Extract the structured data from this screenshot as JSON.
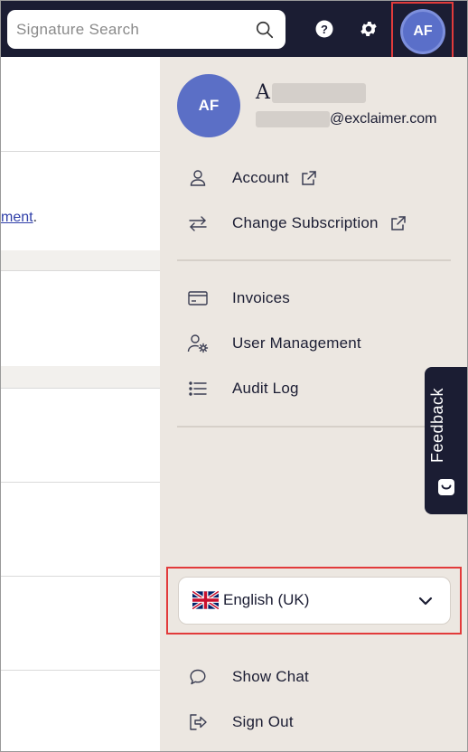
{
  "search": {
    "placeholder": "Signature Search"
  },
  "header": {
    "avatar_initials": "AF"
  },
  "background": {
    "link_tail": "ment",
    "link_after": "."
  },
  "profile": {
    "initials": "AF",
    "name_visible": "A",
    "email_domain": "@exclaimer.com"
  },
  "menu": {
    "account": "Account",
    "change_subscription": "Change Subscription",
    "invoices": "Invoices",
    "user_management": "User Management",
    "audit_log": "Audit Log",
    "show_chat": "Show Chat",
    "sign_out": "Sign Out"
  },
  "feedback": {
    "label": "Feedback"
  },
  "language": {
    "selected": "English (UK)"
  },
  "colors": {
    "topbar": "#1b1d33",
    "panel": "#ece7e1",
    "avatar": "#5b6fc6",
    "highlight": "#e23b3b"
  }
}
